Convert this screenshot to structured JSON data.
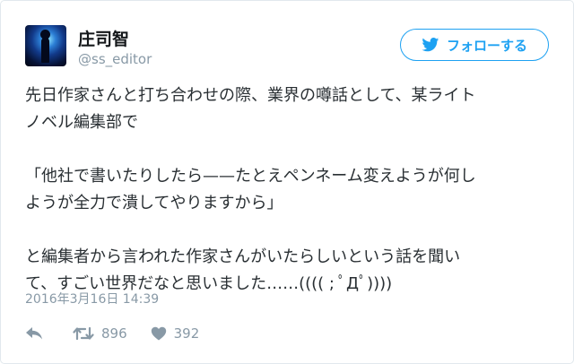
{
  "user": {
    "name": "庄司智",
    "handle": "@ss_editor"
  },
  "follow_button": {
    "label": "フォローする"
  },
  "tweet": {
    "lines": [
      "先日作家さんと打ち合わせの際、業界の噂話として、某ライト",
      "ノベル編集部で",
      "",
      "「他社で書いたりしたら——たとえペンネーム変えようが何し",
      "ようが全力で潰してやりますから」",
      "",
      "と編集者から言われた作家さんがいたらしいという話を聞い",
      "て、すごい世界だなと思いました……(((( ; ﾟДﾟ))))"
    ],
    "timestamp": "2016年3月16日 14:39"
  },
  "actions": {
    "retweets": "896",
    "likes": "392"
  },
  "colors": {
    "accent": "#1da1f2",
    "muted": "#8899a6",
    "text": "#292f33"
  },
  "icons": [
    "bird-icon",
    "reply-icon",
    "retweet-icon",
    "heart-icon"
  ]
}
